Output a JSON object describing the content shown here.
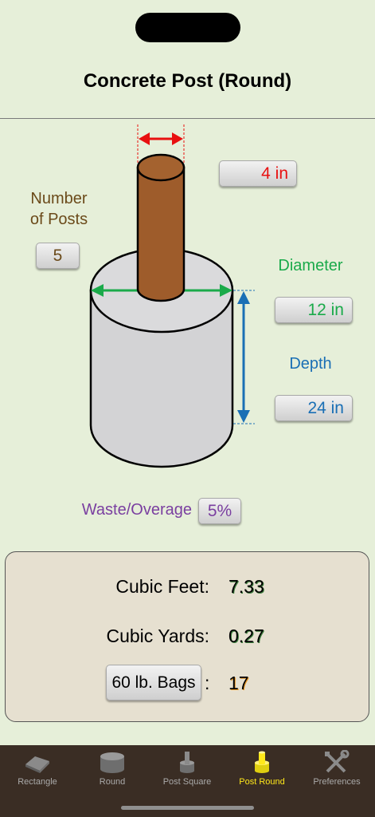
{
  "page": {
    "title": "Concrete Post (Round)"
  },
  "inputs": {
    "post_width": "4 in",
    "number_of_posts_label": "Number\nof Posts",
    "number_of_posts": "5",
    "diameter_label": "Diameter",
    "diameter": "12 in",
    "depth_label": "Depth",
    "depth": "24 in",
    "waste_label": "Waste/Overage",
    "waste": "5%"
  },
  "results": {
    "cubic_feet_label": "Cubic Feet:",
    "cubic_feet": "7.33",
    "cubic_yards_label": "Cubic Yards:",
    "cubic_yards": "0.27",
    "bags_button": "60 lb. Bags",
    "bags_colon": ":",
    "bags": "17"
  },
  "tabs": [
    {
      "label": "Rectangle",
      "icon": "rectangle-slab-icon"
    },
    {
      "label": "Round",
      "icon": "round-slab-icon"
    },
    {
      "label": "Post Square",
      "icon": "post-square-icon"
    },
    {
      "label": "Post Round",
      "icon": "post-round-icon"
    },
    {
      "label": "Preferences",
      "icon": "wrench-screwdriver-icon"
    }
  ],
  "colors": {
    "background": "#e6efd9",
    "post_width": "#e81010",
    "number_of_posts": "#6b4a1a",
    "diameter": "#1aaa4a",
    "depth": "#1a6fb5",
    "waste": "#7a3fa0",
    "active_tab": "#ffe81a",
    "tabbar": "#3a2d24"
  }
}
